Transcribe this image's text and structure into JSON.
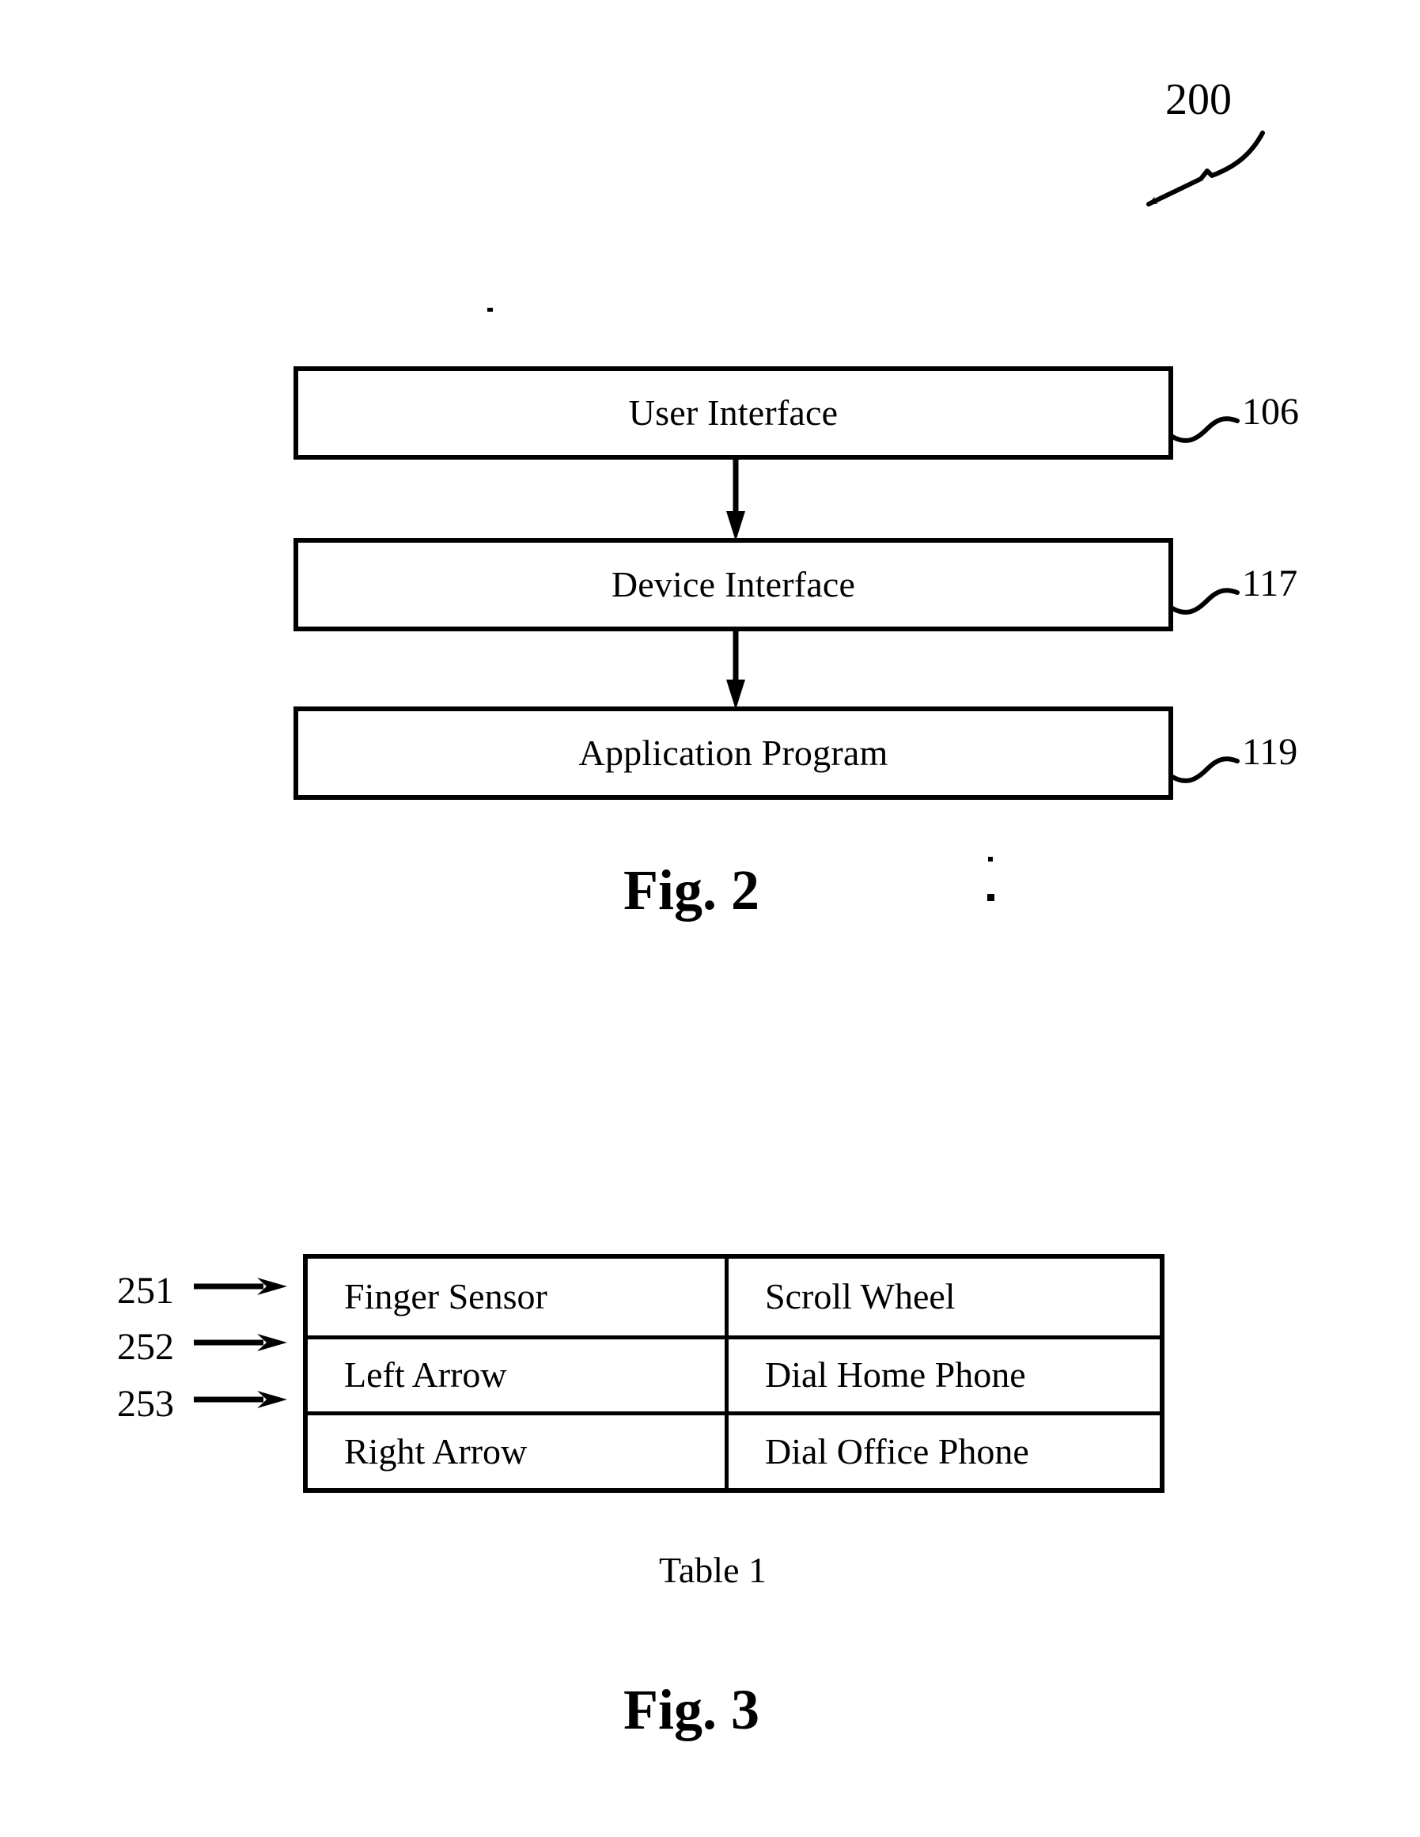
{
  "figure2": {
    "ref_label": "200",
    "caption": "Fig. 2",
    "blocks": [
      {
        "label": "User Interface",
        "ref": "106"
      },
      {
        "label": "Device Interface",
        "ref": "117"
      },
      {
        "label": "Application Program",
        "ref": "119"
      }
    ]
  },
  "figure3": {
    "caption": "Fig. 3",
    "table_caption": "Table 1",
    "table": {
      "row_refs": [
        "251",
        "252",
        "253"
      ],
      "rows": [
        {
          "input": "Finger Sensor",
          "action": "Scroll Wheel"
        },
        {
          "input": "Left Arrow",
          "action": "Dial Home Phone"
        },
        {
          "input": "Right Arrow",
          "action": "Dial Office Phone"
        }
      ]
    }
  },
  "colors": {
    "ink": "#000000",
    "paper": "#ffffff"
  }
}
